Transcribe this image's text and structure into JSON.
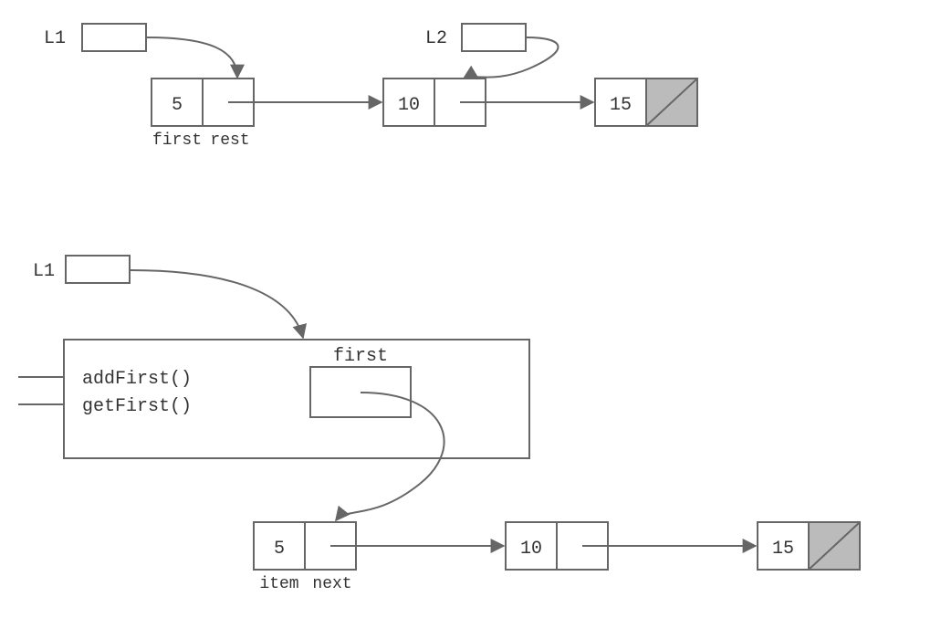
{
  "top": {
    "L1": "L1",
    "L2": "L2",
    "node1": {
      "val": "5",
      "firstLabel": "first",
      "restLabel": "rest"
    },
    "node2": {
      "val": "10"
    },
    "node3": {
      "val": "15"
    }
  },
  "bottom": {
    "L1": "L1",
    "methods": {
      "add": "addFirst()",
      "get": "getFirst()"
    },
    "firstLabel": "first",
    "node1": {
      "val": "5",
      "itemLabel": "item",
      "nextLabel": "next"
    },
    "node2": {
      "val": "10"
    },
    "node3": {
      "val": "15"
    }
  }
}
